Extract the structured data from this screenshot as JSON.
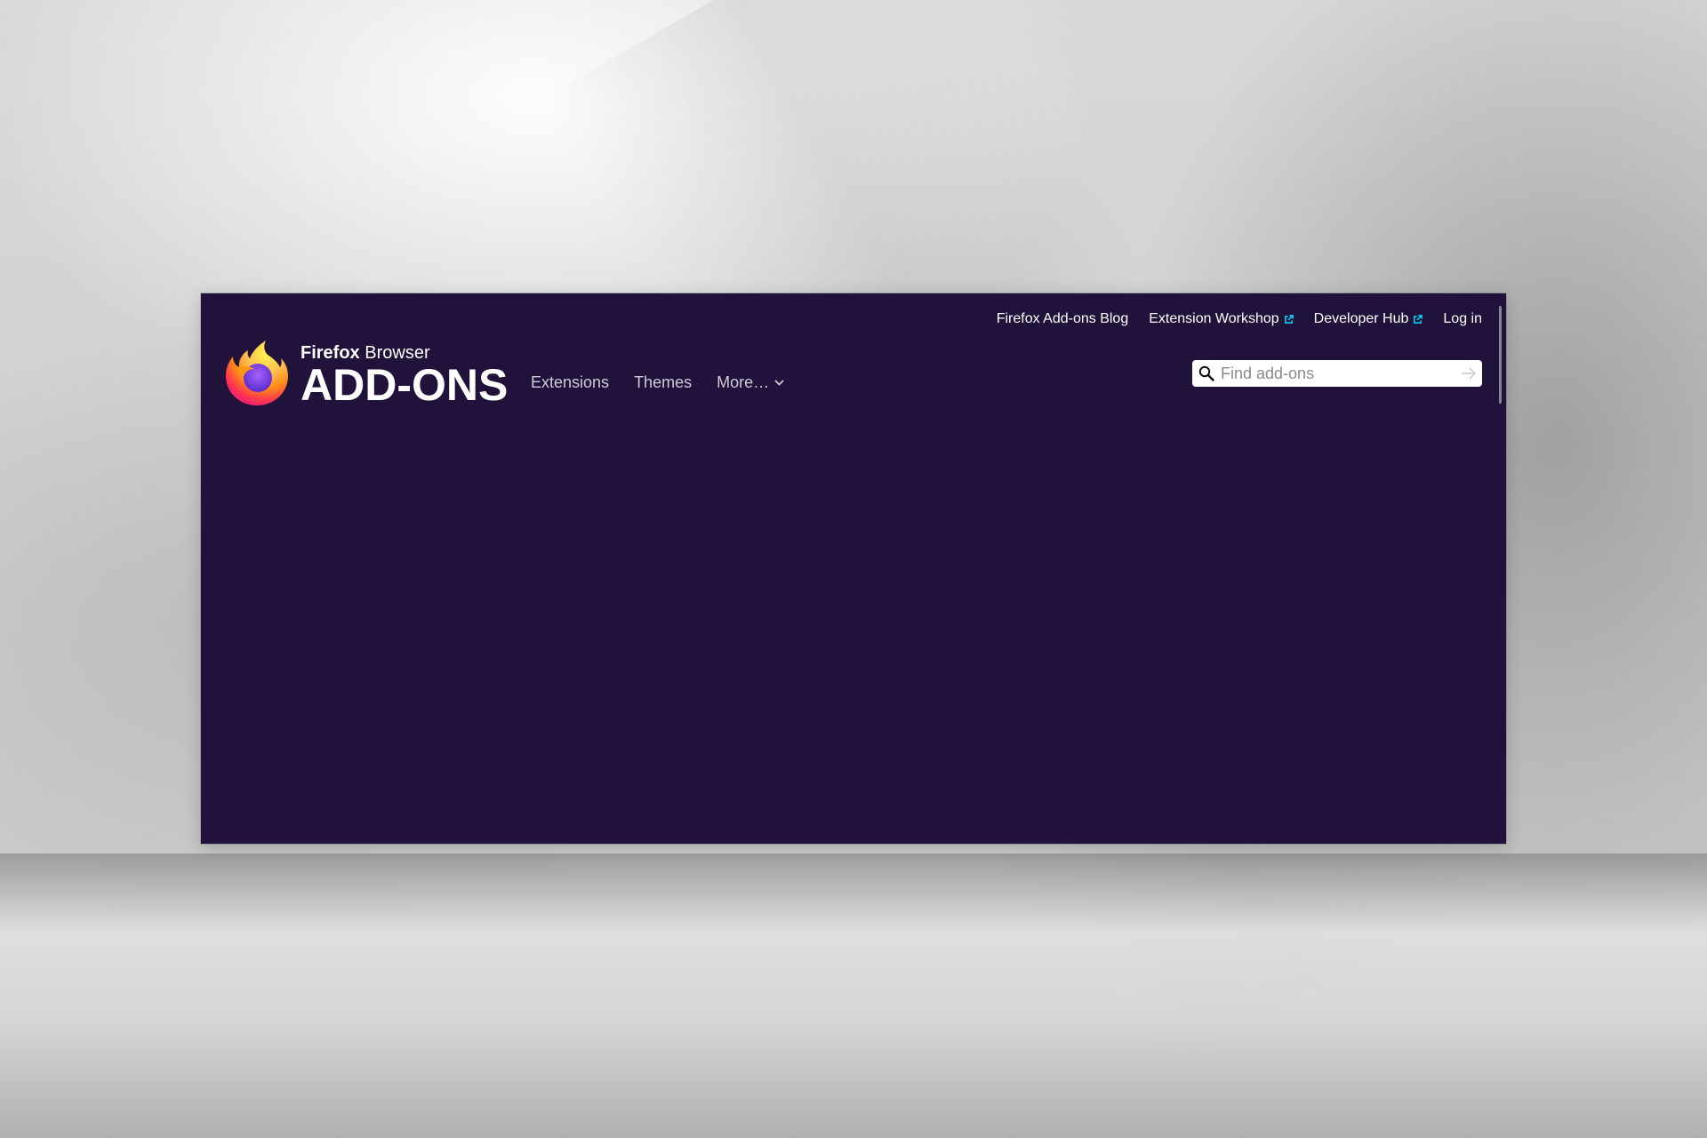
{
  "colors": {
    "header_bg": "#20123a",
    "link_text": "#ffffff",
    "nav_text": "#cfcad8",
    "external_icon": "#00ddff"
  },
  "top_links": {
    "blog": "Firefox Add-ons Blog",
    "workshop": "Extension Workshop",
    "developer_hub": "Developer Hub",
    "login": "Log in",
    "external_icon": "external-link-icon"
  },
  "logo": {
    "brand_bold": "Firefox",
    "brand_light": "Browser",
    "title": "ADD-ONS",
    "icon": "firefox-logo"
  },
  "nav": {
    "extensions": "Extensions",
    "themes": "Themes",
    "more": "More…",
    "more_icon": "chevron-down-icon"
  },
  "search": {
    "placeholder": "Find add-ons",
    "value": "",
    "icon": "search-icon",
    "submit_icon": "arrow-right-icon"
  }
}
